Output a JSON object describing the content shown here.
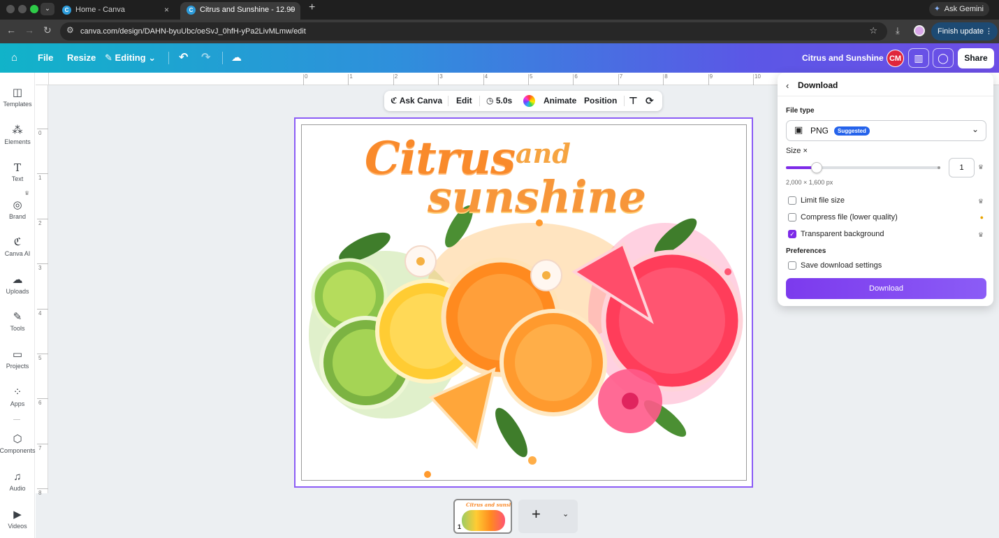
{
  "browser": {
    "tabs": [
      {
        "label": "Home - Canva",
        "active": false
      },
      {
        "label": "Citrus and Sunshine - 12.99",
        "active": true
      }
    ],
    "ask_gemini": "Ask Gemini",
    "url": "canva.com/design/DAHN-byuUbc/oeSvJ_0hfH-yPa2LivMLmw/edit",
    "finish_update": "Finish update"
  },
  "header": {
    "file": "File",
    "resize": "Resize",
    "editing": "Editing",
    "doc_title": "Citrus and Sunshine",
    "avatar": "CM",
    "share": "Share"
  },
  "rail": [
    {
      "label": "Templates",
      "icon": "templates-icon"
    },
    {
      "label": "Elements",
      "icon": "elements-icon"
    },
    {
      "label": "Text",
      "icon": "text-icon"
    },
    {
      "label": "Brand",
      "icon": "brand-icon"
    },
    {
      "label": "Canva AI",
      "icon": "canva-ai-icon"
    },
    {
      "label": "Uploads",
      "icon": "uploads-icon"
    },
    {
      "label": "Tools",
      "icon": "tools-icon"
    },
    {
      "label": "Projects",
      "icon": "projects-icon"
    },
    {
      "label": "Apps",
      "icon": "apps-icon"
    },
    {
      "label": "Components",
      "icon": "components-icon"
    },
    {
      "label": "Audio",
      "icon": "audio-icon"
    },
    {
      "label": "Videos",
      "icon": "videos-icon"
    }
  ],
  "ruler": {
    "top": [
      "0",
      "1",
      "2",
      "3",
      "4",
      "5",
      "6",
      "7",
      "8",
      "9",
      "10"
    ],
    "left": [
      "0",
      "1",
      "2",
      "3",
      "4",
      "5",
      "6",
      "7",
      "8"
    ]
  },
  "toolbar": {
    "ask_canva": "Ask Canva",
    "edit": "Edit",
    "duration": "5.0s",
    "animate": "Animate",
    "position": "Position"
  },
  "artwork": {
    "line1": "Citrus",
    "line1b": "and",
    "line2": "sunshine"
  },
  "pages": {
    "thumb_number": "1",
    "thumb_title": "Citrus and sunshine"
  },
  "download": {
    "title": "Download",
    "file_type_label": "File type",
    "file_type": "PNG",
    "suggested": "Suggested",
    "size_label": "Size ×",
    "size_value": "1",
    "size_fraction": 0.2,
    "dims": "2,000 × 1,600 px",
    "options": [
      {
        "label": "Limit file size",
        "checked": false
      },
      {
        "label": "Compress file (lower quality)",
        "checked": false
      },
      {
        "label": "Transparent background",
        "checked": true
      }
    ],
    "preferences_label": "Preferences",
    "save_settings": "Save download settings",
    "button": "Download"
  },
  "colors": {
    "accent": "#7d2ae8",
    "header_start": "#11b3c9",
    "header_end": "#6d4ee6",
    "selection": "#8b5cf6"
  }
}
